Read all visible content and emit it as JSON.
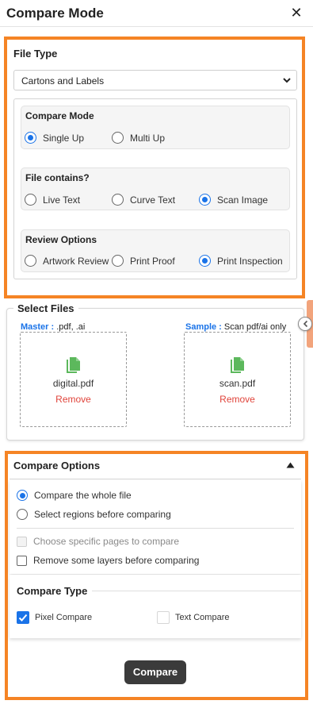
{
  "header": {
    "title": "Compare Mode",
    "close_glyph": "✕"
  },
  "file_type": {
    "title": "File Type",
    "selected": "Cartons and Labels"
  },
  "compare_mode": {
    "title": "Compare Mode",
    "options": [
      {
        "label": "Single Up",
        "checked": true
      },
      {
        "label": "Multi Up",
        "checked": false
      }
    ]
  },
  "file_contains": {
    "title": "File contains?",
    "options": [
      {
        "label": "Live Text",
        "checked": false
      },
      {
        "label": "Curve Text",
        "checked": false
      },
      {
        "label": "Scan Image",
        "checked": true
      }
    ]
  },
  "review_options": {
    "title": "Review Options",
    "options": [
      {
        "label": "Artwork Review",
        "checked": false
      },
      {
        "label": "Print Proof",
        "checked": false
      },
      {
        "label": "Print Inspection",
        "checked": true
      }
    ]
  },
  "select_files": {
    "title": "Select Files",
    "master": {
      "key": "Master :",
      "hint": " .pdf, .ai",
      "file_name": "digital.pdf",
      "remove_label": "Remove"
    },
    "sample": {
      "key": "Sample :",
      "hint": " Scan pdf/ai only",
      "file_name": "scan.pdf",
      "remove_label": "Remove"
    }
  },
  "compare_options": {
    "title": "Compare Options",
    "scope": [
      {
        "label": "Compare the whole file",
        "checked": true
      },
      {
        "label": "Select regions before comparing",
        "checked": false
      }
    ],
    "checkboxes": [
      {
        "label": "Choose specific pages to compare",
        "checked": false,
        "disabled": true
      },
      {
        "label": "Remove some layers before comparing",
        "checked": false,
        "disabled": false
      }
    ]
  },
  "compare_type": {
    "title": "Compare Type",
    "items": [
      {
        "label": "Pixel Compare",
        "checked": true
      },
      {
        "label": "Text Compare",
        "checked": false
      }
    ]
  },
  "actions": {
    "compare_label": "Compare"
  },
  "colors": {
    "accent_orange": "#f58425",
    "primary_blue": "#1a73e8",
    "remove_red": "#e0443b",
    "file_icon_green": "#5cb85c",
    "button_dark": "#3b3b3b"
  }
}
